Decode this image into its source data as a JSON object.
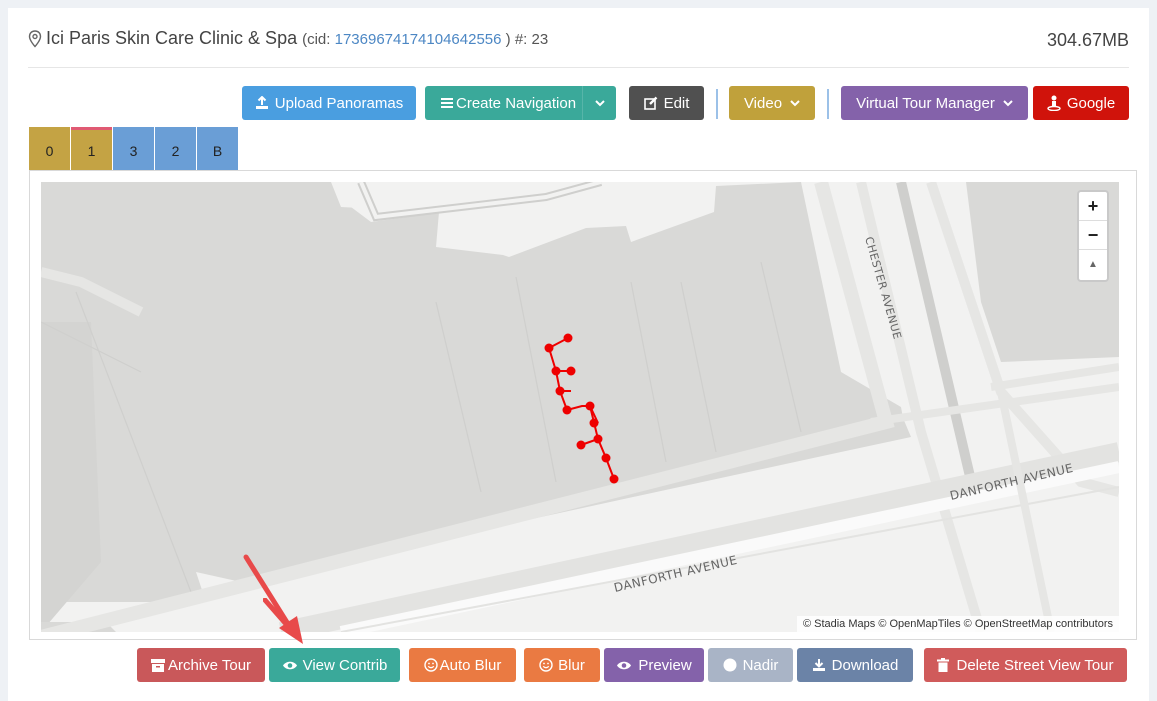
{
  "header": {
    "title": "Ici Paris Skin Care Clinic & Spa",
    "cid_prefix": "(cid:",
    "cid_value": "17369674174104642556",
    "cid_suffix": ") #: 23",
    "size": "304.67MB"
  },
  "toolbar": {
    "upload": "Upload Panoramas",
    "create_nav": "Create Navigation",
    "edit": "Edit",
    "video": "Video",
    "vtm": "Virtual Tour Manager",
    "google": "Google"
  },
  "floor_tabs": [
    "0",
    "1",
    "3",
    "2",
    "B"
  ],
  "map": {
    "street_chester": "CHESTER AVENUE",
    "street_danforth_1": "DANFORTH AVENUE",
    "street_danforth_2": "DANFORTH AVENUE",
    "zoom_in": "+",
    "zoom_out": "−",
    "compass": "▲",
    "attribution": "© Stadia Maps © OpenMapTiles © OpenStreetMap contributors"
  },
  "actions": {
    "archive": "Archive Tour",
    "view_contrib": "View Contrib",
    "auto_blur": "Auto Blur",
    "blur": "Blur",
    "preview": "Preview",
    "nadir": "Nadir",
    "download": "Download",
    "delete": "Delete Street View Tour"
  },
  "colors": {
    "blue": "#4a9ee0",
    "teal": "#3aa99a",
    "dark": "#505050",
    "gold": "#c0a13b",
    "purple": "#8462aa",
    "red": "#d0130b",
    "archive": "#c9585a",
    "orange": "#ea7a42",
    "nadir": "#a9b4c6",
    "download": "#6b83a7",
    "delete": "#d05b5b",
    "tab_gold": "#c4a344",
    "tab_blue": "#6a9ed6",
    "path": "#ee0000"
  }
}
